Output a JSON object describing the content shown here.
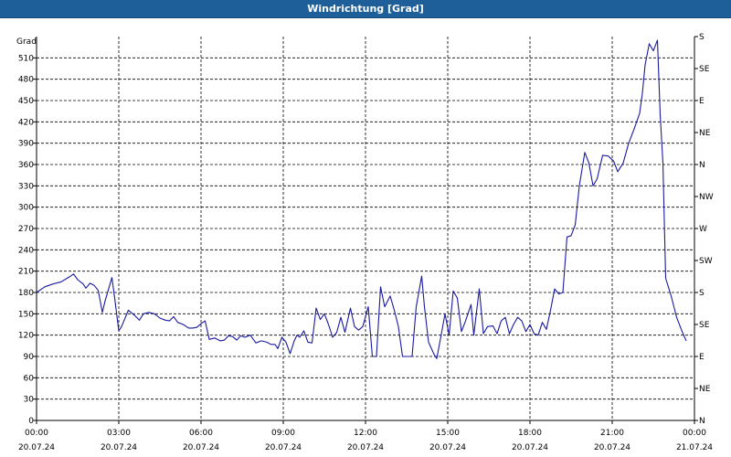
{
  "window": {
    "title": "Windrichtung [Grad]"
  },
  "chart_data": {
    "type": "line",
    "title": "Windrichtung [Grad]",
    "ylabel": "Grad",
    "ylim": [
      0,
      540
    ],
    "y_ticks": [
      0,
      30,
      60,
      90,
      120,
      150,
      180,
      210,
      240,
      270,
      300,
      330,
      360,
      390,
      420,
      450,
      480,
      510
    ],
    "right_axis_labels": [
      "N",
      "NE",
      "E",
      "SE",
      "S",
      "SW",
      "W",
      "NW",
      "N",
      "NE",
      "E",
      "SE",
      "S"
    ],
    "xlim_hours": [
      0,
      24
    ],
    "x_ticks": [
      {
        "h": 0,
        "time": "00:00",
        "date": "20.07.24"
      },
      {
        "h": 3,
        "time": "03:00",
        "date": "20.07.24"
      },
      {
        "h": 6,
        "time": "06:00",
        "date": "20.07.24"
      },
      {
        "h": 9,
        "time": "09:00",
        "date": "20.07.24"
      },
      {
        "h": 12,
        "time": "12:00",
        "date": "20.07.24"
      },
      {
        "h": 15,
        "time": "15:00",
        "date": "20.07.24"
      },
      {
        "h": 18,
        "time": "18:00",
        "date": "20.07.24"
      },
      {
        "h": 21,
        "time": "21:00",
        "date": "20.07.24"
      },
      {
        "h": 24,
        "time": "00:00",
        "date": "21.07.24"
      }
    ],
    "grid": true,
    "line_color": "#1a1aa0",
    "series": [
      {
        "points": [
          [
            0.0,
            180
          ],
          [
            0.3,
            188
          ],
          [
            0.6,
            192
          ],
          [
            0.9,
            195
          ],
          [
            1.2,
            202
          ],
          [
            1.35,
            206
          ],
          [
            1.5,
            198
          ],
          [
            1.7,
            192
          ],
          [
            1.8,
            186
          ],
          [
            1.95,
            193
          ],
          [
            2.1,
            190
          ],
          [
            2.25,
            183
          ],
          [
            2.4,
            152
          ],
          [
            2.5,
            168
          ],
          [
            2.75,
            201
          ],
          [
            2.85,
            172
          ],
          [
            3.0,
            126
          ],
          [
            3.1,
            132
          ],
          [
            3.35,
            155
          ],
          [
            3.6,
            147
          ],
          [
            3.75,
            141
          ],
          [
            3.9,
            150
          ],
          [
            4.1,
            152
          ],
          [
            4.3,
            150
          ],
          [
            4.5,
            144
          ],
          [
            4.7,
            141
          ],
          [
            4.85,
            140
          ],
          [
            5.0,
            146
          ],
          [
            5.15,
            138
          ],
          [
            5.35,
            135
          ],
          [
            5.55,
            130
          ],
          [
            5.7,
            130
          ],
          [
            5.85,
            131
          ],
          [
            6.0,
            136
          ],
          [
            6.15,
            140
          ],
          [
            6.3,
            114
          ],
          [
            6.5,
            116
          ],
          [
            6.7,
            112
          ],
          [
            6.85,
            113
          ],
          [
            7.0,
            119
          ],
          [
            7.15,
            118
          ],
          [
            7.3,
            113
          ],
          [
            7.45,
            119
          ],
          [
            7.6,
            117
          ],
          [
            7.8,
            120
          ],
          [
            8.0,
            109
          ],
          [
            8.2,
            112
          ],
          [
            8.4,
            110
          ],
          [
            8.55,
            107
          ],
          [
            8.7,
            107
          ],
          [
            8.8,
            101
          ],
          [
            8.95,
            117
          ],
          [
            9.1,
            110
          ],
          [
            9.25,
            94
          ],
          [
            9.4,
            112
          ],
          [
            9.5,
            120
          ],
          [
            9.6,
            117
          ],
          [
            9.75,
            126
          ],
          [
            9.9,
            110
          ],
          [
            10.05,
            109
          ],
          [
            10.2,
            158
          ],
          [
            10.35,
            142
          ],
          [
            10.5,
            150
          ],
          [
            10.65,
            135
          ],
          [
            10.8,
            117
          ],
          [
            10.95,
            124
          ],
          [
            11.1,
            145
          ],
          [
            11.25,
            124
          ],
          [
            11.45,
            158
          ],
          [
            11.6,
            132
          ],
          [
            11.75,
            127
          ],
          [
            11.9,
            132
          ],
          [
            12.1,
            160
          ],
          [
            12.25,
            90
          ],
          [
            12.4,
            90
          ],
          [
            12.55,
            188
          ],
          [
            12.7,
            160
          ],
          [
            12.9,
            175
          ],
          [
            13.05,
            155
          ],
          [
            13.2,
            132
          ],
          [
            13.35,
            90
          ],
          [
            13.5,
            90
          ],
          [
            13.7,
            90
          ],
          [
            13.85,
            160
          ],
          [
            14.05,
            203
          ],
          [
            14.15,
            160
          ],
          [
            14.3,
            110
          ],
          [
            14.5,
            93
          ],
          [
            14.6,
            87
          ],
          [
            14.75,
            118
          ],
          [
            14.9,
            150
          ],
          [
            15.05,
            120
          ],
          [
            15.2,
            182
          ],
          [
            15.35,
            172
          ],
          [
            15.5,
            125
          ],
          [
            15.65,
            140
          ],
          [
            15.85,
            163
          ],
          [
            15.95,
            120
          ],
          [
            16.15,
            185
          ],
          [
            16.3,
            122
          ],
          [
            16.45,
            132
          ],
          [
            16.65,
            133
          ],
          [
            16.8,
            122
          ],
          [
            16.95,
            140
          ],
          [
            17.1,
            145
          ],
          [
            17.25,
            122
          ],
          [
            17.4,
            135
          ],
          [
            17.55,
            145
          ],
          [
            17.7,
            140
          ],
          [
            17.85,
            125
          ],
          [
            18.0,
            135
          ],
          [
            18.15,
            122
          ],
          [
            18.3,
            120
          ],
          [
            18.45,
            138
          ],
          [
            18.6,
            128
          ],
          [
            18.75,
            155
          ],
          [
            18.9,
            185
          ],
          [
            19.05,
            178
          ],
          [
            19.2,
            180
          ],
          [
            19.35,
            258
          ],
          [
            19.5,
            260
          ],
          [
            19.65,
            275
          ],
          [
            19.8,
            330
          ],
          [
            20.0,
            377
          ],
          [
            20.15,
            362
          ],
          [
            20.3,
            330
          ],
          [
            20.45,
            340
          ],
          [
            20.65,
            373
          ],
          [
            20.85,
            372
          ],
          [
            21.05,
            365
          ],
          [
            21.2,
            350
          ],
          [
            21.4,
            362
          ],
          [
            21.6,
            390
          ],
          [
            21.8,
            410
          ],
          [
            22.0,
            432
          ],
          [
            22.1,
            460
          ],
          [
            22.2,
            500
          ],
          [
            22.35,
            530
          ],
          [
            22.5,
            520
          ],
          [
            22.65,
            535
          ],
          [
            22.75,
            430
          ],
          [
            22.85,
            362
          ],
          [
            22.95,
            200
          ],
          [
            23.15,
            175
          ],
          [
            23.35,
            145
          ],
          [
            23.55,
            125
          ],
          [
            23.7,
            112
          ]
        ]
      }
    ]
  }
}
